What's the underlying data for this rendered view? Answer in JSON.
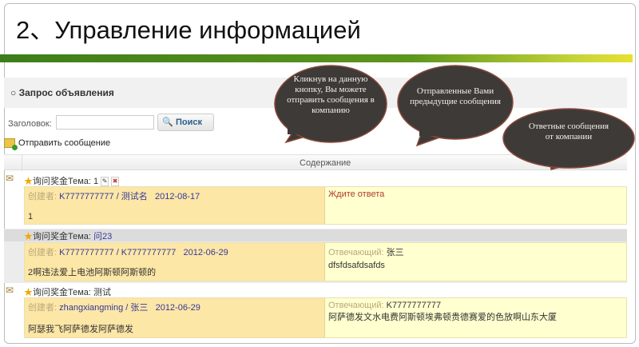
{
  "slide_title": "2、Управление информацией",
  "panel": {
    "title": "Запрос объявления",
    "search_label": "Заголовок:",
    "search_value": "",
    "search_button": "Поиск",
    "send_message": "Отправить сообщение",
    "column_header": "Содержание"
  },
  "messages": [
    {
      "topic_prefix": "询问奖金Тема:",
      "topic": "1",
      "creator_label": "创建者:",
      "creator": "K7777777777 / 测试名",
      "date": "2012-08-17",
      "body": "1",
      "status": "Ждите ответа",
      "responder_label": "",
      "responder": "",
      "reply": ""
    },
    {
      "topic_prefix": "询问奖金Тема:",
      "topic": "问23",
      "creator_label": "创建者:",
      "creator": "K7777777777 / K7777777777",
      "date": "2012-06-29",
      "body": "2啊违法爱上电池阿斯顿阿斯顿的",
      "status": "",
      "responder_label": "Отвечающий:",
      "responder": "张三",
      "reply": "dfsfdsafdsafds"
    },
    {
      "topic_prefix": "询问奖金Тема:",
      "topic": "测试",
      "creator_label": "创建者:",
      "creator": "zhangxiangming / 张三",
      "date": "2012-06-29",
      "body": "阿瑟我飞阿萨德发阿萨德发",
      "status": "",
      "responder_label": "Отвечающий:",
      "responder": "K7777777777",
      "reply": "阿萨德发文水电费阿斯顿埃弗顿贵德赛爱的色放啊山东大厦"
    }
  ],
  "callouts": [
    {
      "text": "Кликнув на данную кнопку, Вы можете отправить сообщения в компанию"
    },
    {
      "text": "Отправленные Вами предыдущие сообщения"
    },
    {
      "text": "Ответные сообщения от компании"
    }
  ],
  "colors": {
    "callout": "#3d3a38",
    "accent_green": "#4f8a1c",
    "row_left": "#fde7a6",
    "row_right": "#ffffcf"
  }
}
